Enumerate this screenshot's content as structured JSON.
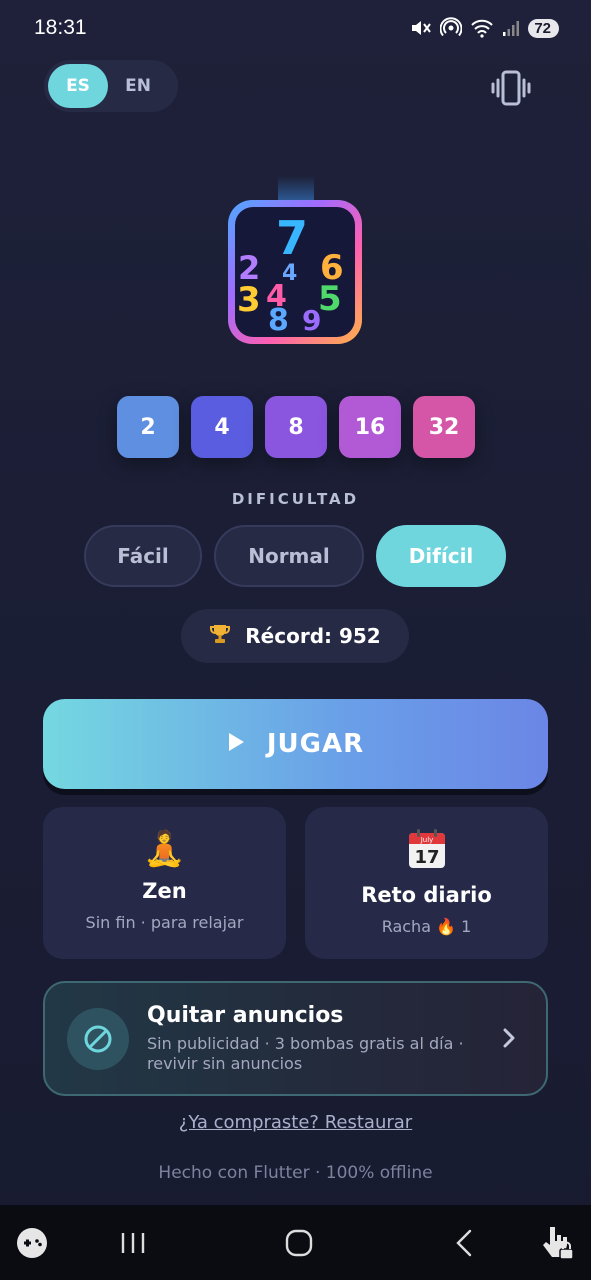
{
  "status_bar": {
    "time": "18:31",
    "battery": "72",
    "icons": [
      "mute-icon",
      "hotspot-icon",
      "wifi-icon",
      "signal-icon",
      "battery-icon"
    ]
  },
  "language": {
    "options": [
      "ES",
      "EN"
    ],
    "selected": "ES"
  },
  "vibration": {
    "icon": "vibrate-icon"
  },
  "logo": {
    "digits": [
      "7",
      "2",
      "4",
      "6",
      "3",
      "4",
      "5",
      "8",
      "9"
    ]
  },
  "tiles": [
    {
      "value": "2",
      "color": "#5f8fe0"
    },
    {
      "value": "4",
      "color": "#5a5ddf"
    },
    {
      "value": "8",
      "color": "#8a55df"
    },
    {
      "value": "16",
      "color": "#b25ad6"
    },
    {
      "value": "32",
      "color": "#d555a6"
    }
  ],
  "difficulty": {
    "label": "DIFICULTAD",
    "options": [
      "Fácil",
      "Normal",
      "Difícil"
    ],
    "selected": "Difícil"
  },
  "record": {
    "icon": "trophy-icon",
    "text": "Récord: 952"
  },
  "play": {
    "label": "JUGAR",
    "icon": "play-icon"
  },
  "modes": {
    "zen": {
      "emoji": "🧘",
      "title": "Zen",
      "subtitle": "Sin fin · para relajar"
    },
    "daily": {
      "emoji": "📅",
      "calendar_month": "July",
      "calendar_day": "17",
      "title": "Reto diario",
      "subtitle_prefix": "Racha",
      "streak_emoji": "🔥",
      "streak": "1"
    }
  },
  "remove_ads": {
    "icon": "no-ads-icon",
    "title": "Quitar anuncios",
    "subtitle": "Sin publicidad · 3 bombas gratis al día · revivir sin anuncios"
  },
  "restore_link": "¿Ya compraste? Restaurar",
  "footer": "Hecho con Flutter · 100% offline",
  "colors": {
    "accent": "#6fd6de",
    "background": "#1e2139",
    "card": "#262a48"
  },
  "nav_bar": [
    "gamepad-icon",
    "recent-apps-icon",
    "home-icon",
    "back-icon",
    "touch-lock-icon"
  ]
}
